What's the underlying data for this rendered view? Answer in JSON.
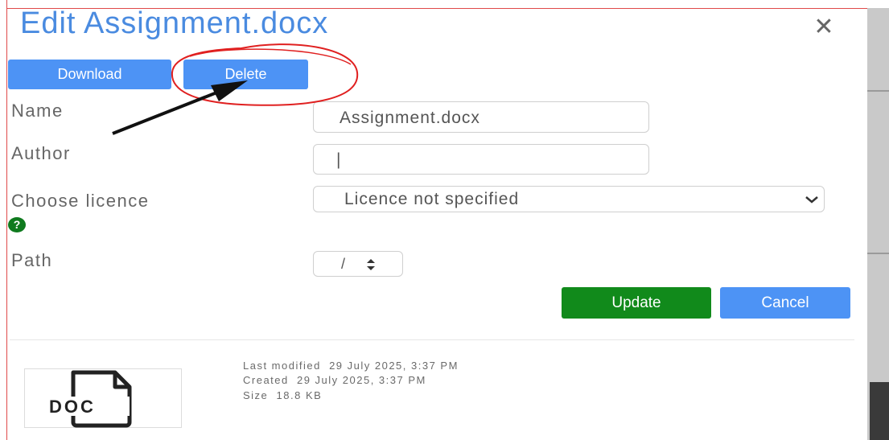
{
  "dialog": {
    "title": "Edit Assignment.docx",
    "close_icon": "close-icon"
  },
  "actions": {
    "download_label": "Download",
    "delete_label": "Delete"
  },
  "form": {
    "name_label": "Name",
    "name_value": "Assignment.docx",
    "author_label": "Author",
    "author_value": "|",
    "licence_label": "Choose licence",
    "licence_value": "Licence not specified",
    "help_icon": "help-icon",
    "path_label": "Path",
    "path_value": "/"
  },
  "buttons": {
    "update_label": "Update",
    "cancel_label": "Cancel"
  },
  "file_info": {
    "last_modified_label": "Last modified",
    "last_modified_value": "29 July 2025, 3:37 PM",
    "created_label": "Created",
    "created_value": "29 July 2025, 3:37 PM",
    "size_label": "Size",
    "size_value": "18.8 KB",
    "icon_text": "DOC"
  },
  "colors": {
    "title": "#4a8be0",
    "primary": "#4d93f5",
    "success": "#118a1b",
    "annotation": "#e02020"
  }
}
